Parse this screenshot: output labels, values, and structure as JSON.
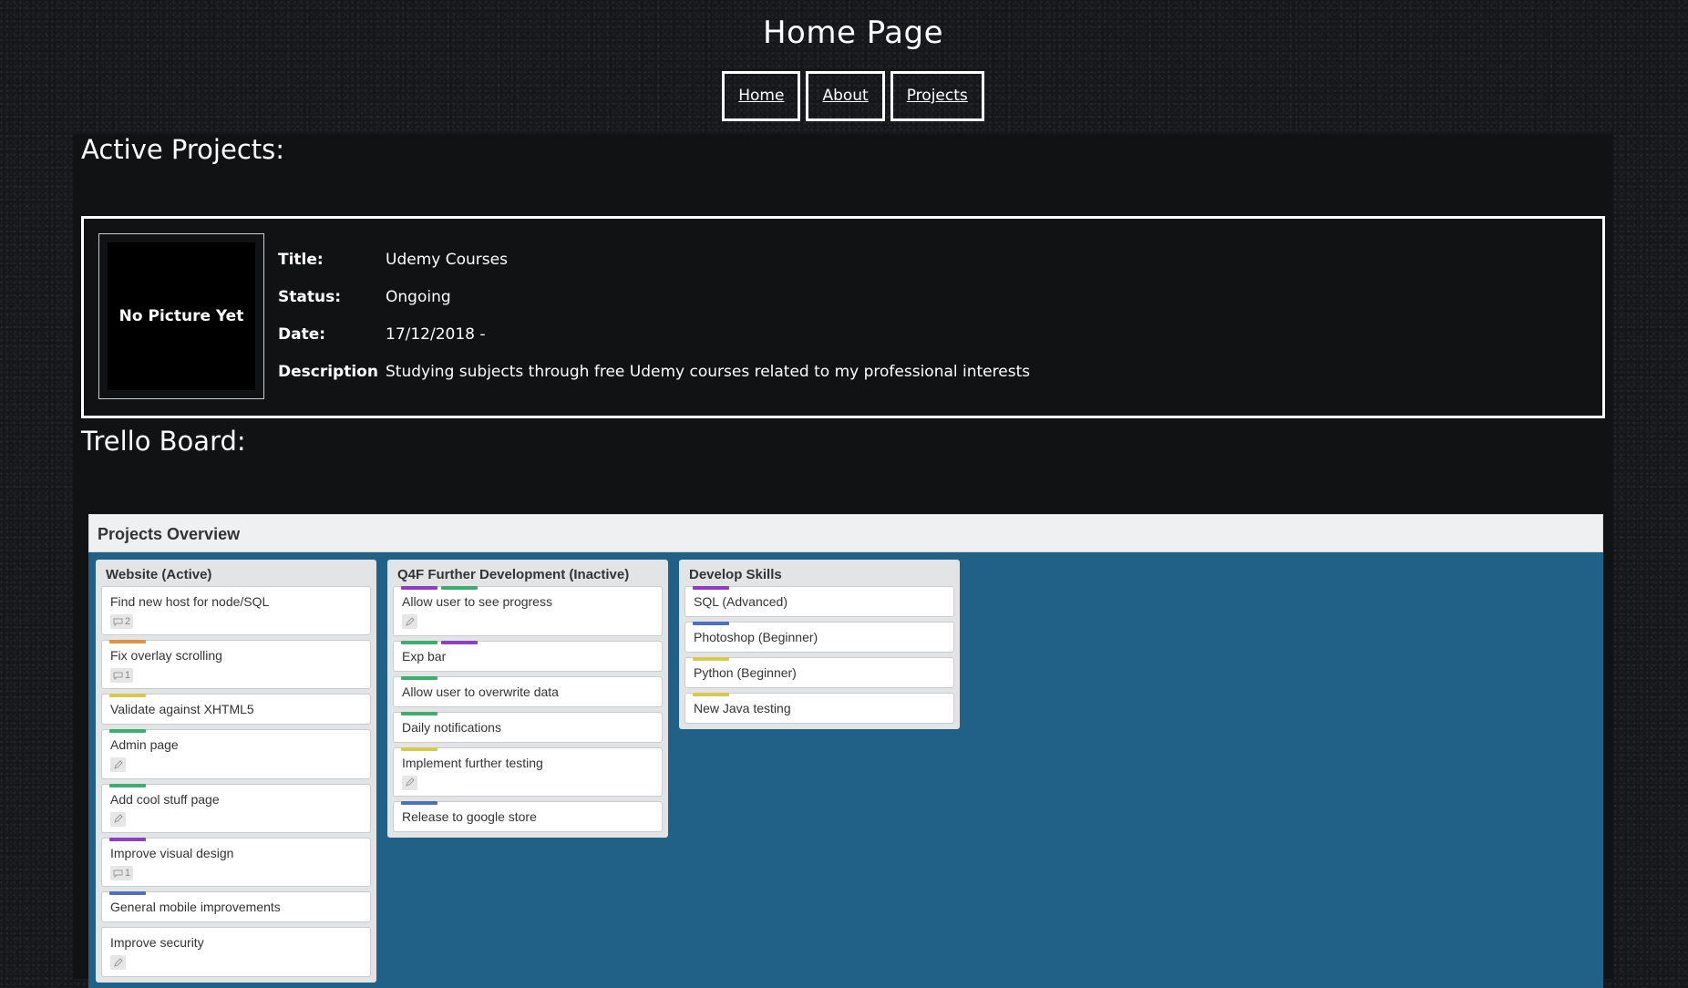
{
  "page": {
    "title": "Home Page"
  },
  "nav": {
    "items": [
      {
        "label": "Home"
      },
      {
        "label": "About"
      },
      {
        "label": "Projects"
      }
    ]
  },
  "active_projects": {
    "heading": "Active Projects:",
    "picture_placeholder": "No Picture Yet",
    "fields": [
      {
        "label": "Title:",
        "value": "Udemy Courses"
      },
      {
        "label": "Status:",
        "value": "Ongoing"
      },
      {
        "label": "Date:",
        "value": "17/12/2018 -"
      },
      {
        "label": "Description",
        "value": "Studying subjects through free Udemy courses related to my professional interests"
      }
    ]
  },
  "trello": {
    "heading": "Trello Board:",
    "board_title": "Projects Overview",
    "colors": {
      "board_bg": "#216087",
      "green": "#3dad72",
      "purple": "#8e3fc0",
      "orange": "#e09442",
      "yellow": "#d8c94c",
      "blue": "#4f6fbf"
    },
    "lists": [
      {
        "title": "Website (Active)",
        "cards": [
          {
            "title": "Find new host for node/SQL",
            "labels": [],
            "badge": {
              "type": "comment-icon",
              "text": "2"
            }
          },
          {
            "title": "Fix overlay scrolling",
            "labels": [
              "orange"
            ],
            "badge": {
              "type": "comment-icon",
              "text": "1"
            }
          },
          {
            "title": "Validate against XHTML5",
            "labels": [
              "yellow"
            ],
            "badge": null
          },
          {
            "title": "Admin page",
            "labels": [
              "green"
            ],
            "badge": {
              "type": "description-icon",
              "text": ""
            }
          },
          {
            "title": "Add cool stuff page",
            "labels": [
              "green"
            ],
            "badge": {
              "type": "description-icon",
              "text": ""
            }
          },
          {
            "title": "Improve visual design",
            "labels": [
              "purple"
            ],
            "badge": {
              "type": "comment-icon",
              "text": "1"
            }
          },
          {
            "title": "General mobile improvements",
            "labels": [
              "blue"
            ],
            "badge": null
          },
          {
            "title": "Improve security",
            "labels": [],
            "badge": {
              "type": "description-icon",
              "text": ""
            }
          }
        ]
      },
      {
        "title": "Q4F Further Development (Inactive)",
        "cards": [
          {
            "title": "Allow user to see progress",
            "labels": [
              "purple",
              "green"
            ],
            "badge": {
              "type": "description-icon",
              "text": ""
            }
          },
          {
            "title": "Exp bar",
            "labels": [
              "green",
              "purple"
            ],
            "badge": null
          },
          {
            "title": "Allow user to overwrite data",
            "labels": [
              "green"
            ],
            "badge": null
          },
          {
            "title": "Daily notifications",
            "labels": [
              "green"
            ],
            "badge": null
          },
          {
            "title": "Implement further testing",
            "labels": [
              "yellow"
            ],
            "badge": {
              "type": "description-icon",
              "text": ""
            }
          },
          {
            "title": "Release to google store",
            "labels": [
              "blue"
            ],
            "badge": null
          }
        ]
      },
      {
        "title": "Develop Skills",
        "cards": [
          {
            "title": "SQL (Advanced)",
            "labels": [
              "purple"
            ],
            "badge": null
          },
          {
            "title": "Photoshop (Beginner)",
            "labels": [
              "blue"
            ],
            "badge": null
          },
          {
            "title": "Python (Beginner)",
            "labels": [
              "yellow"
            ],
            "badge": null
          },
          {
            "title": "New Java testing",
            "labels": [
              "yellow"
            ],
            "badge": null
          }
        ]
      }
    ]
  }
}
